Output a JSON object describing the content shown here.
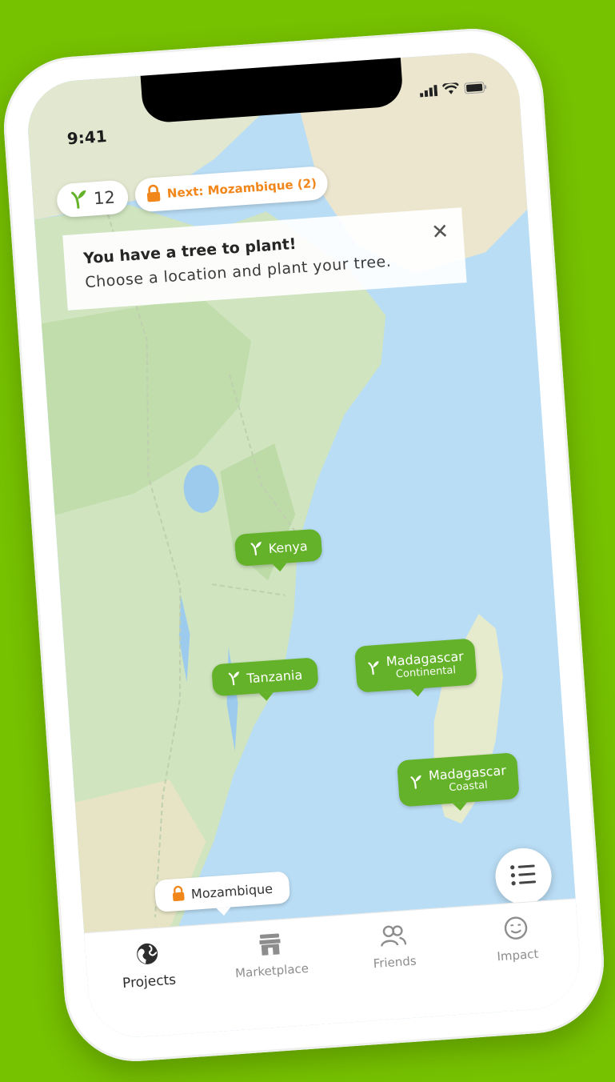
{
  "status_bar": {
    "time": "9:41"
  },
  "header": {
    "tree_count": "12",
    "next_label": "Next: Mozambique (2)"
  },
  "banner": {
    "title": "You have a tree to plant!",
    "subtitle": "Choose a location and plant your tree.",
    "close_icon": "close-icon"
  },
  "map": {
    "pins": [
      {
        "name": "Kenya",
        "sub": "",
        "locked": false
      },
      {
        "name": "Tanzania",
        "sub": "",
        "locked": false
      },
      {
        "name": "Madagascar",
        "sub": "Continental",
        "locked": false
      },
      {
        "name": "Madagascar",
        "sub": "Coastal",
        "locked": false
      },
      {
        "name": "Mozambique",
        "sub": "",
        "locked": true
      }
    ]
  },
  "tabbar": {
    "tabs": [
      {
        "label": "Projects",
        "icon": "globe-icon",
        "active": true
      },
      {
        "label": "Marketplace",
        "icon": "store-icon",
        "active": false
      },
      {
        "label": "Friends",
        "icon": "friends-icon",
        "active": false
      },
      {
        "label": "Impact",
        "icon": "smile-icon",
        "active": false
      }
    ]
  },
  "colors": {
    "background": "#76c100",
    "pin_green": "#64b22a",
    "accent_orange": "#f1861a",
    "ocean": "#b9ddf5",
    "land": "#cfe4bf"
  }
}
